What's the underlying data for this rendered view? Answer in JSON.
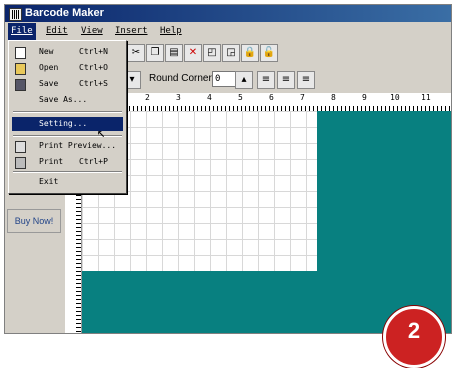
{
  "window": {
    "title": "Barcode Maker"
  },
  "menubar": {
    "items": [
      "File",
      "Edit",
      "View",
      "Insert",
      "Help"
    ]
  },
  "file_menu": {
    "items": [
      {
        "label": "New",
        "shortcut": "Ctrl+N"
      },
      {
        "label": "Open",
        "shortcut": "Ctrl+O"
      },
      {
        "label": "Save",
        "shortcut": "Ctrl+S"
      },
      {
        "label": "Save As..."
      },
      {
        "label": "Setting..."
      },
      {
        "label": "Print Preview..."
      },
      {
        "label": "Print",
        "shortcut": "Ctrl+P"
      },
      {
        "label": "Exit"
      }
    ]
  },
  "format_bar": {
    "round_corner_label": "Round Corner:",
    "round_corner_value": "0"
  },
  "ruler": {
    "ticks": [
      "2",
      "3",
      "4",
      "5",
      "6",
      "7",
      "8",
      "9",
      "10",
      "11"
    ]
  },
  "sidebar": {
    "buy_label": "Buy Now!"
  },
  "badge": {
    "label": "2"
  },
  "colors": {
    "canvas_bg": "#088080",
    "highlight": "#0a246a",
    "badge": "#cc2222"
  }
}
